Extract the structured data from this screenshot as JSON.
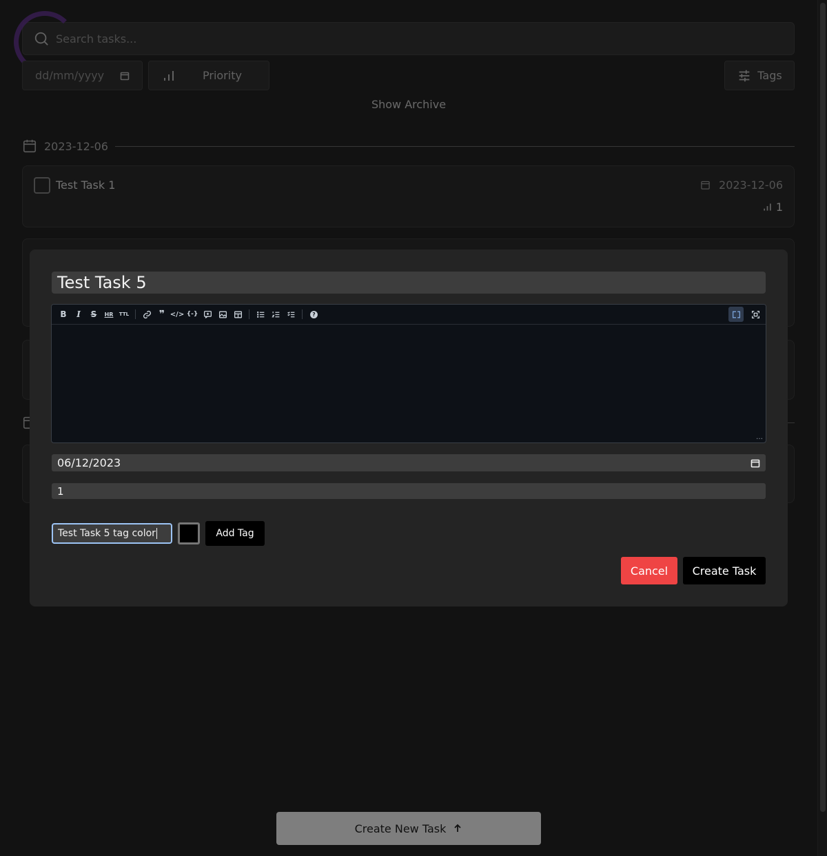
{
  "search": {
    "placeholder": "Search tasks..."
  },
  "filters": {
    "date_placeholder": "dd/mm/yyyy",
    "priority_label": "Priority",
    "tags_label": "Tags",
    "show_archive": "Show Archive"
  },
  "groups": [
    {
      "date": "2023-12-06"
    }
  ],
  "tasks": [
    {
      "title": "Test Task 1",
      "date": "2023-12-06",
      "priority": "1"
    }
  ],
  "modal": {
    "title_value": "Test Task 5",
    "date_value": "06/12/2023",
    "priority_value": "1",
    "tag_input_value": "Test Task 5 tag color",
    "tag_color": "#000000",
    "add_tag_label": "Add Tag",
    "cancel_label": "Cancel",
    "create_label": "Create Task",
    "editor_toolbar": [
      "bold-icon",
      "italic-icon",
      "strikethrough-icon",
      "hr-icon",
      "title-icon",
      "link-icon",
      "quote-icon",
      "code-icon",
      "code-block-icon",
      "comment-icon",
      "image-icon",
      "table-icon",
      "unordered-list-icon",
      "ordered-list-icon",
      "checked-list-icon",
      "help-icon",
      "live-preview-icon",
      "fullscreen-icon"
    ]
  },
  "footer": {
    "create_new_task_label": "Create New Task"
  },
  "colors": {
    "accent_cancel": "#ef4444",
    "background": "#121212",
    "modal_bg": "#242424",
    "editor_bg": "#0d1117"
  }
}
